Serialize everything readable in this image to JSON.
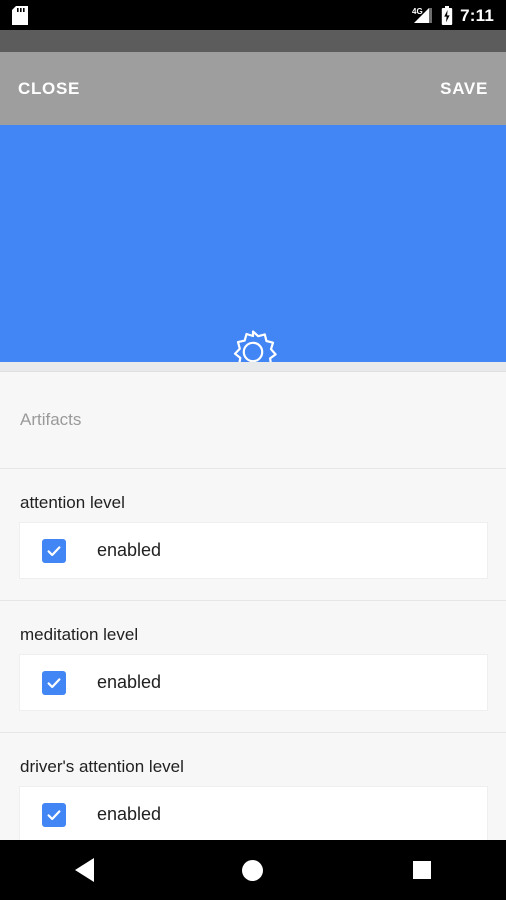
{
  "status_bar": {
    "icons": [
      "sd-card-icon",
      "signal-4g-icon",
      "battery-charging-icon"
    ],
    "network_label": "4G",
    "time": "7:11"
  },
  "toolbar": {
    "close_label": "CLOSE",
    "save_label": "SAVE",
    "background_color": "#9e9e9e"
  },
  "hero": {
    "icon": "gear-icon",
    "title": "Settings",
    "background_color": "#4285f4"
  },
  "content": {
    "section_header": "Artifacts",
    "preferences": [
      {
        "label": "attention level",
        "checkbox_label": "enabled",
        "checked": true
      },
      {
        "label": "meditation level",
        "checkbox_label": "enabled",
        "checked": true
      },
      {
        "label": "driver's attention level",
        "checkbox_label": "enabled",
        "checked": true
      }
    ]
  },
  "nav_bar": {
    "back": "back-icon",
    "home": "home-icon",
    "recents": "recents-icon"
  },
  "colors": {
    "accent": "#4285f4",
    "toolbar": "#9e9e9e",
    "page_background": "#f7f7f7",
    "card": "#ffffff"
  }
}
